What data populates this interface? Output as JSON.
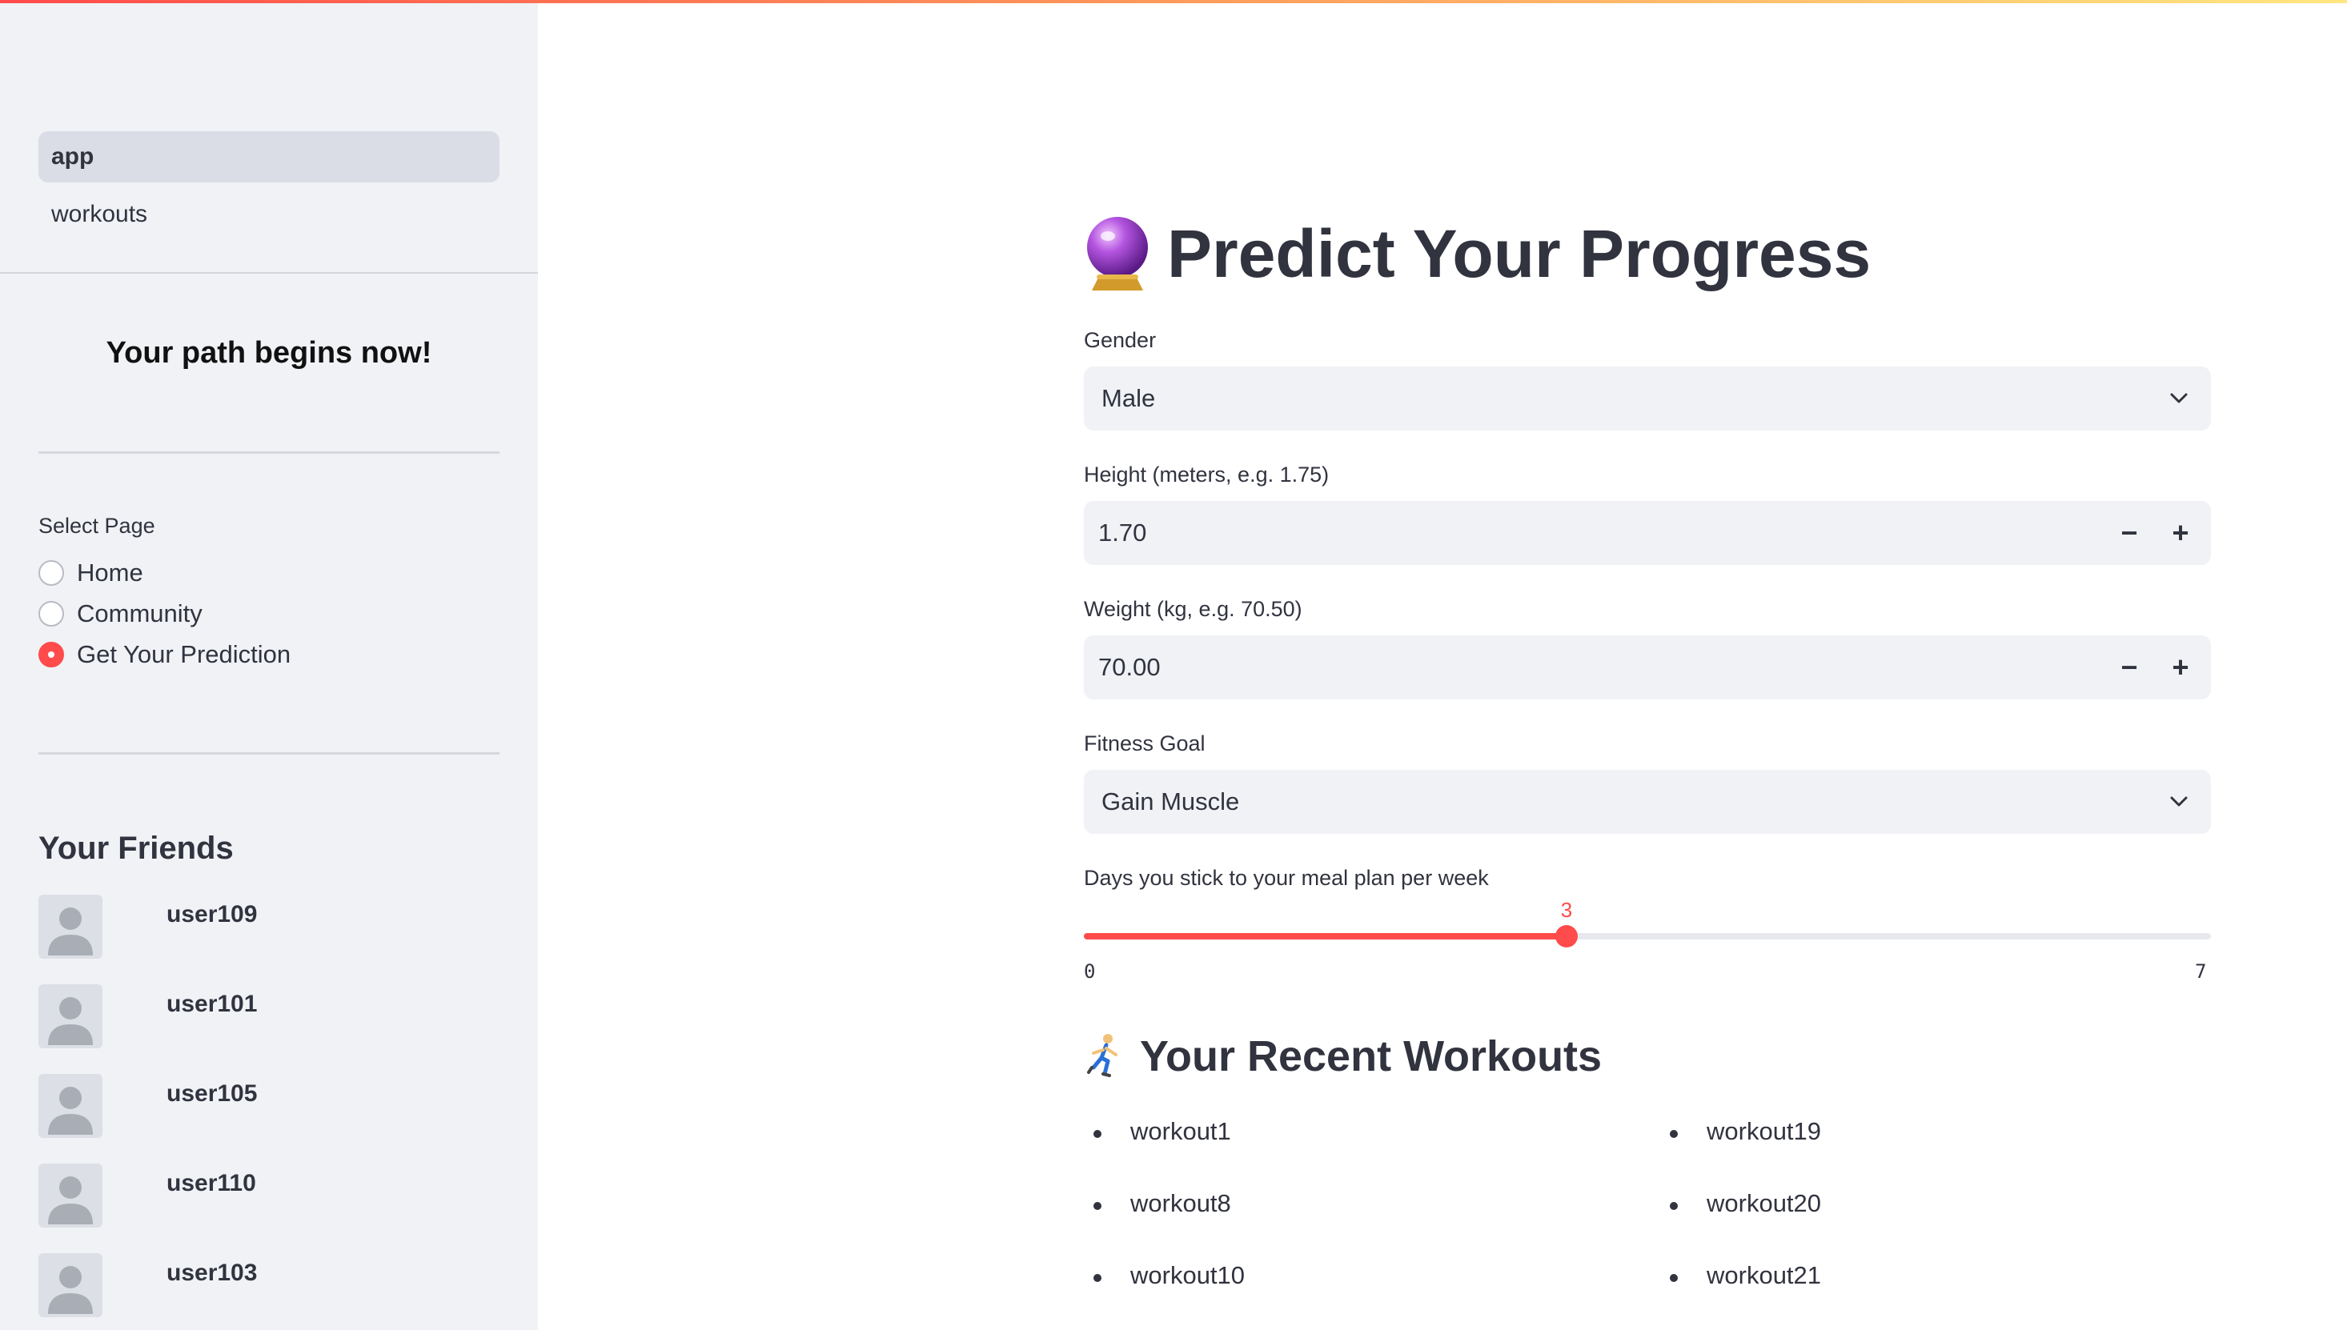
{
  "theme": {
    "accent": "#ff4b4b",
    "sidebar_bg": "#f0f2f6",
    "text": "#31333f"
  },
  "sidebar": {
    "nav": [
      {
        "label": "app",
        "active": true
      },
      {
        "label": "workouts",
        "active": false
      }
    ],
    "heading": "Your path begins now!",
    "select_page": {
      "label": "Select Page",
      "options": [
        "Home",
        "Community",
        "Get Your Prediction"
      ],
      "selected": "Get Your Prediction"
    },
    "friends": {
      "title": "Your Friends",
      "users": [
        "user109",
        "user101",
        "user105",
        "user110",
        "user103"
      ]
    }
  },
  "main": {
    "title": "Predict Your Progress",
    "title_icon": "crystal-ball-icon",
    "gender": {
      "label": "Gender",
      "value": "Male"
    },
    "height": {
      "label": "Height (meters, e.g. 1.75)",
      "value": "1.70",
      "minus": "−",
      "plus": "+"
    },
    "weight": {
      "label": "Weight (kg, e.g. 70.50)",
      "value": "70.00",
      "minus": "−",
      "plus": "+"
    },
    "goal": {
      "label": "Fitness Goal",
      "value": "Gain Muscle"
    },
    "meal_plan": {
      "label": "Days you stick to your meal plan per week",
      "value": 3,
      "min": 0,
      "max": 7
    },
    "workouts": {
      "title": "Your Recent Workouts",
      "title_icon": "runner-icon",
      "left": [
        "workout1",
        "workout8",
        "workout10"
      ],
      "right": [
        "workout19",
        "workout20",
        "workout21"
      ]
    }
  }
}
